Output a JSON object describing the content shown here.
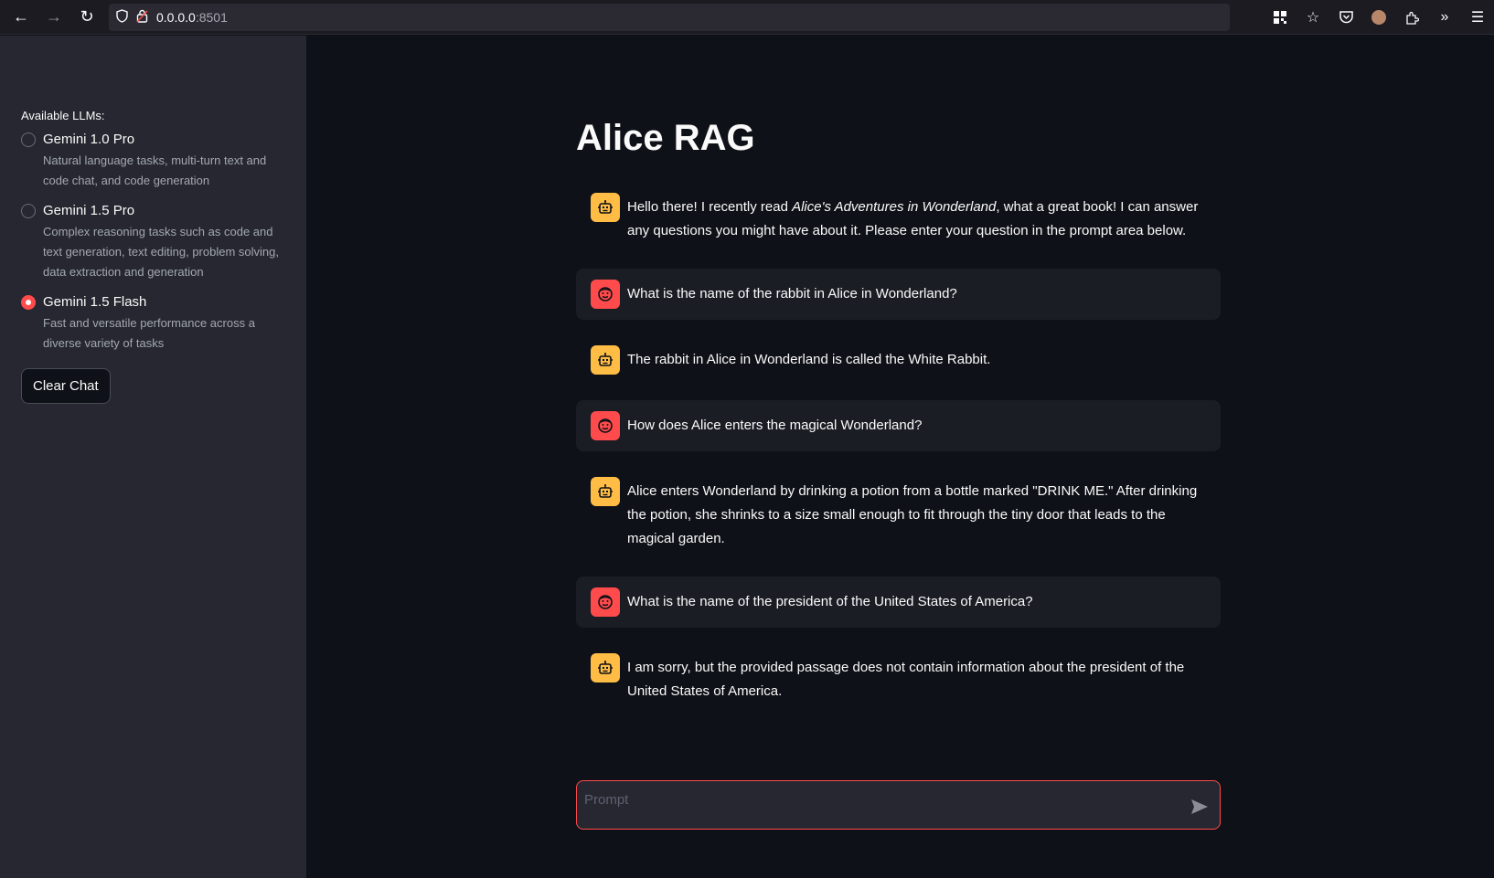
{
  "browser": {
    "url_host": "0.0.0.0",
    "url_port": ":8501"
  },
  "sidebar": {
    "label": "Available LLMs:",
    "options": [
      {
        "title": "Gemini 1.0 Pro",
        "desc": "Natural language tasks, multi-turn text and code chat, and code generation",
        "selected": false
      },
      {
        "title": "Gemini 1.5 Pro",
        "desc": "Complex reasoning tasks such as code and text generation, text editing, problem solving, data extraction and generation",
        "selected": false
      },
      {
        "title": "Gemini 1.5 Flash",
        "desc": "Fast and versatile performance across a diverse variety of tasks",
        "selected": true
      }
    ],
    "clear_button": "Clear Chat"
  },
  "main": {
    "title": "Alice RAG",
    "messages": [
      {
        "role": "assistant",
        "pre": "Hello there! I recently read ",
        "italic": "Alice's Adventures in Wonderland",
        "post": ", what a great book! I can answer any questions you might have about it. Please enter your question in the prompt area below."
      },
      {
        "role": "user",
        "text": "What is the name of the rabbit in Alice in Wonderland?"
      },
      {
        "role": "assistant",
        "text": "The rabbit in Alice in Wonderland is called the White Rabbit."
      },
      {
        "role": "user",
        "text": "How does Alice enters the magical Wonderland?"
      },
      {
        "role": "assistant",
        "text": "Alice enters Wonderland by drinking a potion from a bottle marked \"DRINK ME.\" After drinking the potion, she shrinks to a size small enough to fit through the tiny door that leads to the magical garden."
      },
      {
        "role": "user",
        "text": "What is the name of the president of the United States of America?"
      },
      {
        "role": "assistant",
        "text": "I am sorry, but the provided passage does not contain information about the president of the United States of America."
      }
    ],
    "prompt_placeholder": "Prompt"
  },
  "colors": {
    "accent": "#ff4b4b",
    "bot_avatar": "#ffbd45",
    "sidebar_bg": "#262730",
    "main_bg": "#0e1117"
  }
}
